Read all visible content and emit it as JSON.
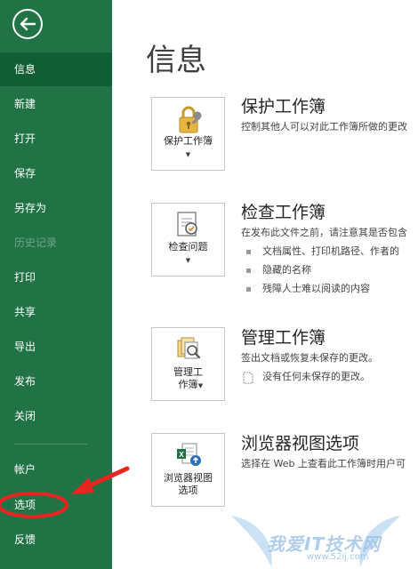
{
  "sidebar": {
    "back_icon": "back-arrow-icon",
    "items": [
      {
        "label": "信息",
        "state": "selected"
      },
      {
        "label": "新建",
        "state": "normal"
      },
      {
        "label": "打开",
        "state": "normal"
      },
      {
        "label": "保存",
        "state": "normal"
      },
      {
        "label": "另存为",
        "state": "normal"
      },
      {
        "label": "历史记录",
        "state": "disabled"
      },
      {
        "label": "打印",
        "state": "normal"
      },
      {
        "label": "共享",
        "state": "normal"
      },
      {
        "label": "导出",
        "state": "normal"
      },
      {
        "label": "发布",
        "state": "normal"
      },
      {
        "label": "关闭",
        "state": "normal"
      },
      {
        "label": "帐户",
        "state": "normal"
      },
      {
        "label": "选项",
        "state": "normal",
        "annotated": true
      },
      {
        "label": "反馈",
        "state": "normal"
      }
    ],
    "background_color": "#217346",
    "selected_color": "#0f5e34"
  },
  "main": {
    "title": "信息",
    "sections": [
      {
        "button_label": "保护工作簿",
        "button_icon": "lock-key-icon",
        "title": "保护工作簿",
        "description": "控制其他人可以对此工作簿所做的更改"
      },
      {
        "button_label": "检查问题",
        "button_icon": "inspect-document-icon",
        "title": "检查工作簿",
        "description": "在发布此文件之前，请注意其是否包含",
        "bullets": [
          "文档属性、打印机路径、作者的",
          "隐藏的名称",
          "残障人士难以阅读的内容"
        ]
      },
      {
        "button_label_line1": "管理工",
        "button_label_line2": "作簿",
        "button_icon": "manage-workbook-icon",
        "title": "管理工作簿",
        "description": "签出文档或恢复未保存的更改。",
        "note": "没有任何未保存的更改。",
        "note_icon": "blank-page-icon"
      },
      {
        "button_label_line1": "浏览器视图",
        "button_label_line2": "选项",
        "button_icon": "browser-view-icon",
        "title": "浏览器视图选项",
        "description": "选择在 Web 上查看此工作簿时用户可"
      }
    ]
  },
  "annotation": {
    "arrow_color": "#e8251f"
  },
  "watermark": {
    "text": "我爱IT技术网",
    "url": "www.52ij.com"
  }
}
